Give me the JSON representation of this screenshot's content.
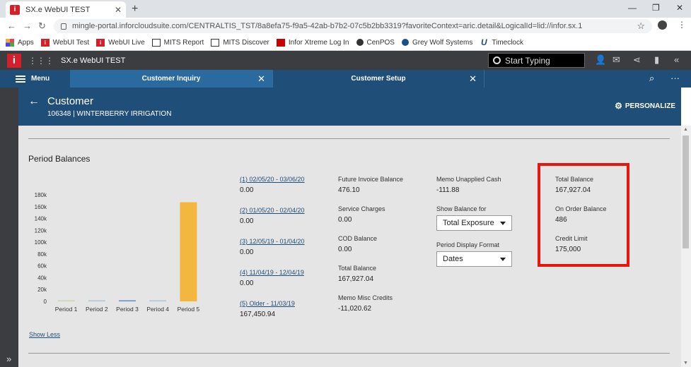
{
  "browser": {
    "tab_title": "SX.e WebUI TEST",
    "url": "mingle-portal.inforcloudsuite.com/CENTRALTIS_TST/8a8efa75-f9a5-42ab-b7b2-07c5b2bb3319?favoriteContext=aric.detail&LogicalId=lid://infor.sx.1",
    "bookmarks": [
      {
        "label": "Apps",
        "icon": "apps-grid-icon"
      },
      {
        "label": "WebUI Test",
        "icon": "infor-i-icon"
      },
      {
        "label": "WebUI Live",
        "icon": "infor-i-icon"
      },
      {
        "label": "MITS Report",
        "icon": "mits-icon"
      },
      {
        "label": "MITS Discover",
        "icon": "mits-icon"
      },
      {
        "label": "Infor Xtreme Log In",
        "icon": "infor-logo-icon"
      },
      {
        "label": "CenPOS",
        "icon": "cenpos-icon"
      },
      {
        "label": "Grey Wolf Systems",
        "icon": "greywolf-icon"
      },
      {
        "label": "Timeclock",
        "icon": "u-icon"
      }
    ]
  },
  "app": {
    "title": "SX.e WebUI TEST",
    "search_placeholder": "Start Typing"
  },
  "tabs": {
    "menu_label": "Menu",
    "items": [
      {
        "label": "Customer Inquiry",
        "active": true
      },
      {
        "label": "Customer Setup",
        "active": false
      }
    ]
  },
  "customer": {
    "title": "Customer",
    "subtitle": "106348 | WINTERBERRY IRRIGATION",
    "personalize_label": "PERSONALIZE"
  },
  "period_balances": {
    "section_title": "Period Balances",
    "periods": [
      {
        "label": "(1) 02/05/20 - 03/06/20",
        "value": "0.00"
      },
      {
        "label": "(2) 01/05/20 - 02/04/20",
        "value": "0.00"
      },
      {
        "label": "(3) 12/05/19 - 01/04/20",
        "value": "0.00"
      },
      {
        "label": "(4) 11/04/19 - 12/04/19",
        "value": "0.00"
      },
      {
        "label": "(5) Older - 11/03/19",
        "value": "167,450.94"
      }
    ],
    "col2": [
      {
        "label": "Future Invoice Balance",
        "value": "476.10"
      },
      {
        "label": "Service Charges",
        "value": "0.00"
      },
      {
        "label": "COD Balance",
        "value": "0.00"
      },
      {
        "label": "Total Balance",
        "value": "167,927.04"
      },
      {
        "label": "Memo Misc Credits",
        "value": "-11,020.62"
      }
    ],
    "memo_unapplied_cash": {
      "label": "Memo Unapplied Cash",
      "value": "-111.88"
    },
    "show_balance_for": {
      "label": "Show Balance for",
      "value": "Total Exposure"
    },
    "period_display_format": {
      "label": "Period Display Format",
      "value": "Dates"
    },
    "col4": [
      {
        "label": "Total Balance",
        "value": "167,927.04"
      },
      {
        "label": "On Order Balance",
        "value": "486"
      },
      {
        "label": "Credit Limit",
        "value": "175,000"
      }
    ],
    "show_less_label": "Show Less"
  },
  "chart_data": {
    "type": "bar",
    "categories": [
      "Period 1",
      "Period 2",
      "Period 3",
      "Period 4",
      "Period 5"
    ],
    "values": [
      0,
      0,
      0,
      0,
      167450.94
    ],
    "y_ticks": [
      "0",
      "20k",
      "40k",
      "60k",
      "80k",
      "100k",
      "120k",
      "140k",
      "160k",
      "180k"
    ],
    "ylim": [
      0,
      180000
    ],
    "bar_colors": [
      "#c9d8a8",
      "#a9c5d8",
      "#5b8fc9",
      "#a9c5d8",
      "#f3b73f"
    ]
  }
}
